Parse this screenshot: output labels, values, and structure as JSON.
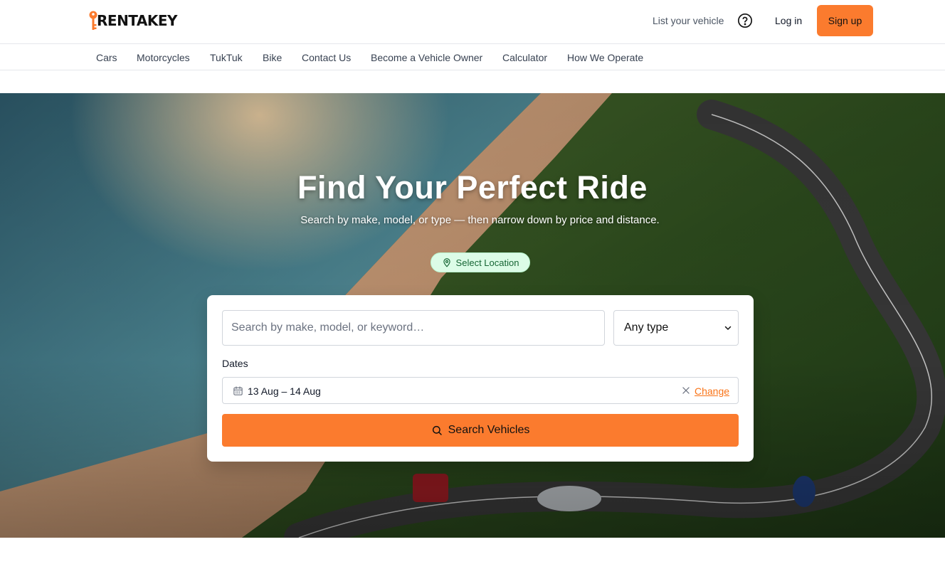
{
  "brand": {
    "logo_text": "RENTAKEY",
    "accent_color": "#fb7b2e"
  },
  "header": {
    "list_vehicle_label": "List your vehicle",
    "help_icon": "help-circle-icon",
    "login_label": "Log in",
    "signup_label": "Sign up"
  },
  "nav": {
    "items": [
      {
        "label": "Cars"
      },
      {
        "label": "Motorcycles"
      },
      {
        "label": "TukTuk"
      },
      {
        "label": "Bike"
      },
      {
        "label": "Contact Us"
      },
      {
        "label": "Become a Vehicle Owner"
      },
      {
        "label": "Calculator"
      },
      {
        "label": "How We Operate"
      }
    ]
  },
  "hero": {
    "title": "Find Your Perfect Ride",
    "subtitle": "Search by make, model, or type — then narrow down by price and distance.",
    "location_button": "Select Location",
    "location_icon": "map-pin-icon",
    "pill_color": "#dcfce7"
  },
  "search": {
    "placeholder": "Search by make, model, or keyword…",
    "value": "",
    "type_selected": "Any type",
    "dates_label": "Dates",
    "dates_value": "13 Aug – 14 Aug",
    "calendar_icon": "calendar-icon",
    "clear_icon": "close-icon",
    "change_label": "Change",
    "button_label": "Search Vehicles",
    "button_icon": "search-icon"
  }
}
